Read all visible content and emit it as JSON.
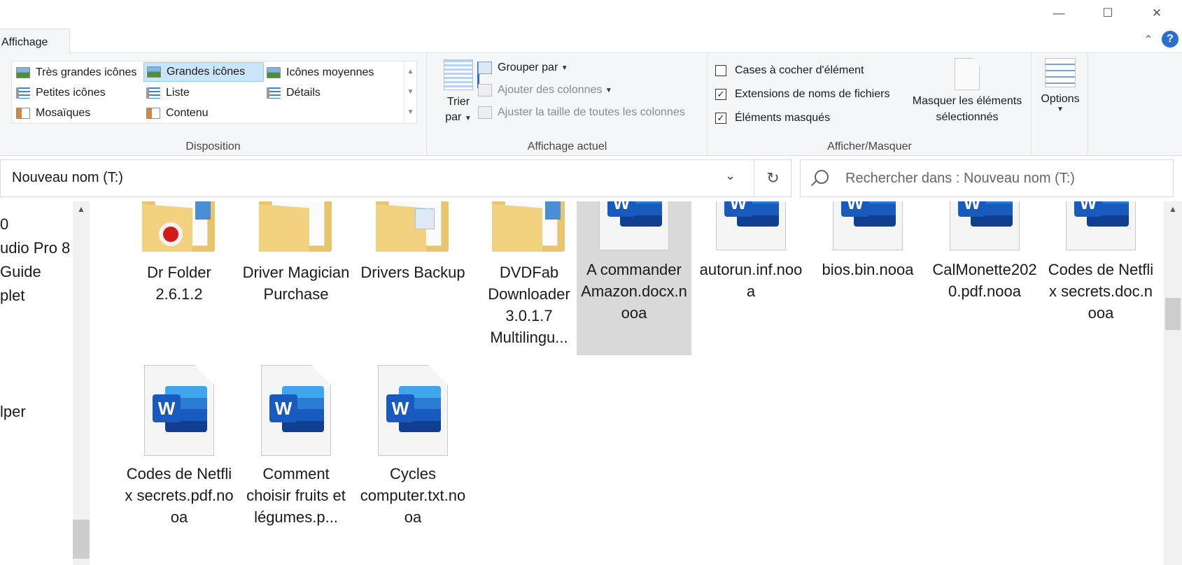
{
  "ribbon": {
    "tab_label": "Affichage",
    "groups": {
      "disposition": {
        "label": "Disposition",
        "items": [
          {
            "label": "Très grandes icônes",
            "selected": false,
            "icon": "extra-large-icons-icon"
          },
          {
            "label": "Grandes icônes",
            "selected": true,
            "icon": "large-icons-icon"
          },
          {
            "label": "Icônes moyennes",
            "selected": false,
            "icon": "medium-icons-icon"
          },
          {
            "label": "Petites icônes",
            "selected": false,
            "icon": "small-icons-icon"
          },
          {
            "label": "Liste",
            "selected": false,
            "icon": "list-icon"
          },
          {
            "label": "Détails",
            "selected": false,
            "icon": "details-icon"
          },
          {
            "label": "Mosaïques",
            "selected": false,
            "icon": "tiles-icon"
          },
          {
            "label": "Contenu",
            "selected": false,
            "icon": "content-icon"
          }
        ]
      },
      "affichage_actuel": {
        "label": "Affichage actuel",
        "trier_line1": "Trier",
        "trier_line2": "par",
        "grouper": "Grouper par",
        "ajouter": "Ajouter des colonnes",
        "ajuster": "Ajuster la taille de toutes les colonnes"
      },
      "afficher_masquer": {
        "label": "Afficher/Masquer",
        "checkboxes": [
          {
            "label": "Cases à cocher d'élément",
            "checked": false
          },
          {
            "label": "Extensions de noms de fichiers",
            "checked": true
          },
          {
            "label": "Éléments masqués",
            "checked": true
          }
        ],
        "masquer_line1": "Masquer les éléments",
        "masquer_line2": "sélectionnés"
      },
      "options": {
        "label": "Options"
      }
    }
  },
  "address": {
    "path": "Nouveau nom (T:)",
    "search_placeholder": "Rechercher dans : Nouveau nom (T:)"
  },
  "nav_items": [
    "0",
    "udio Pro 8",
    "Guide",
    "plet",
    "lper"
  ],
  "files": [
    {
      "name": "Dr Folder 2.6.1.2",
      "type": "folder",
      "badge": "red",
      "selected": false
    },
    {
      "name": "Driver Magician Purchase",
      "type": "folder",
      "badge": "none",
      "selected": false
    },
    {
      "name": "Drivers Backup",
      "type": "folder",
      "badge": "doc",
      "selected": false
    },
    {
      "name": "DVDFab Downloader 3.0.1.7 Multilingu...",
      "type": "folder",
      "badge": "blue",
      "selected": false
    },
    {
      "name": "A commander Amazon.docx.nooa",
      "type": "word",
      "selected": true
    },
    {
      "name": "autorun.inf.nooa",
      "type": "word",
      "selected": false
    },
    {
      "name": "bios.bin.nooa",
      "type": "word",
      "selected": false
    },
    {
      "name": "CalMonette2020.pdf.nooa",
      "type": "word",
      "selected": false
    },
    {
      "name": "Codes de Netflix secrets.doc.nooa",
      "type": "word",
      "selected": false
    },
    {
      "name": "Codes de Netflix secrets.pdf.nooa",
      "type": "word",
      "selected": false
    },
    {
      "name": "Comment choisir fruits et légumes.p...",
      "type": "word",
      "selected": false
    },
    {
      "name": "Cycles computer.txt.nooa",
      "type": "word",
      "selected": false
    }
  ],
  "colors": {
    "accent": "#2a70c9",
    "selection": "#cce4f7",
    "word_blue": "#185abd",
    "folder_yellow": "#f3d27f"
  }
}
